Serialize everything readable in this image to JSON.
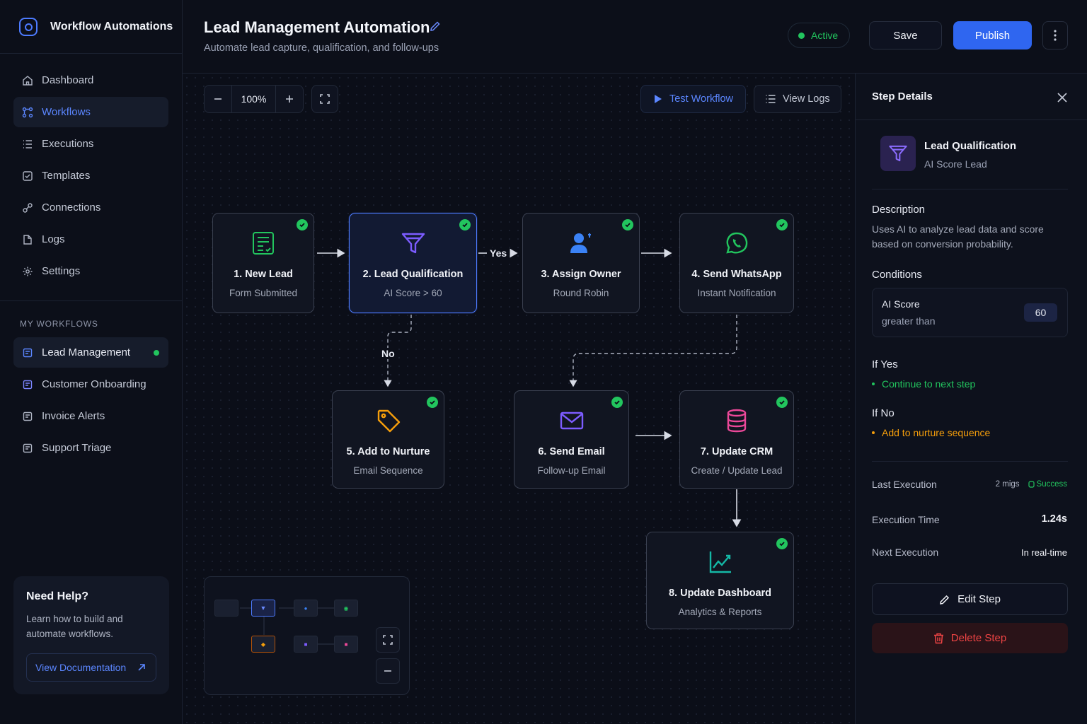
{
  "app": {
    "title": "Workflow Automations"
  },
  "nav": [
    {
      "label": "Dashboard",
      "icon": "home-icon",
      "active": false
    },
    {
      "label": "Workflows",
      "icon": "workflow-icon",
      "active": true
    },
    {
      "label": "Executions",
      "icon": "list-icon",
      "active": false
    },
    {
      "label": "Templates",
      "icon": "template-icon",
      "active": false
    },
    {
      "label": "Connections",
      "icon": "plug-icon",
      "active": false
    },
    {
      "label": "Logs",
      "icon": "file-icon",
      "active": false
    },
    {
      "label": "Settings",
      "icon": "gear-icon",
      "active": false
    }
  ],
  "my_workflows": {
    "heading": "MY WORKFLOWS",
    "items": [
      {
        "label": "Lead Management",
        "active": true
      },
      {
        "label": "Customer Onboarding",
        "active": false
      },
      {
        "label": "Invoice Alerts",
        "active": false
      },
      {
        "label": "Support Triage",
        "active": false
      }
    ]
  },
  "help": {
    "title": "Need Help?",
    "text": "Learn how to build and automate workflows.",
    "link": "View Documentation"
  },
  "header": {
    "title": "Lead Management Automation",
    "subtitle": "Automate lead capture, qualification, and follow-ups",
    "status": "Active",
    "save": "Save",
    "publish": "Publish"
  },
  "toolbar": {
    "zoom": "100%",
    "test": "Test Workflow",
    "logs": "View Logs"
  },
  "nodes": [
    {
      "title": "1. New Lead",
      "sub": "Form Submitted",
      "icon": "form-icon",
      "color": "#22c55e"
    },
    {
      "title": "2. Lead Qualification",
      "sub": "AI Score > 60",
      "icon": "filter-icon",
      "color": "#7c5cff"
    },
    {
      "title": "3. Assign Owner",
      "sub": "Round Robin",
      "icon": "user-icon",
      "color": "#3b82f6"
    },
    {
      "title": "4. Send WhatsApp",
      "sub": "Instant Notification",
      "icon": "whatsapp-icon",
      "color": "#22c55e"
    },
    {
      "title": "5. Add to Nurture",
      "sub": "Email Sequence",
      "icon": "tag-icon",
      "color": "#f59e0b"
    },
    {
      "title": "6. Send Email",
      "sub": "Follow-up Email",
      "icon": "mail-icon",
      "color": "#7c5cff"
    },
    {
      "title": "7. Update CRM",
      "sub": "Create / Update Lead",
      "icon": "database-icon",
      "color": "#ec4899"
    },
    {
      "title": "8. Update Dashboard",
      "sub": "Analytics & Reports",
      "icon": "chart-icon",
      "color": "#14b8a6"
    }
  ],
  "edges": {
    "yes": "Yes",
    "no": "No"
  },
  "panel": {
    "title": "Step Details",
    "step_title": "Lead Qualification",
    "step_sub": "AI Score Lead",
    "description_label": "Description",
    "description": "Uses AI to analyze lead data and score based on conversion probability.",
    "conditions_label": "Conditions",
    "condition": {
      "field": "AI Score",
      "operator": "greater than",
      "value": "60"
    },
    "if_yes_label": "If Yes",
    "if_yes": "Continue to next step",
    "if_no_label": "If No",
    "if_no": "Add to nurture sequence",
    "last_execution_label": "Last Execution",
    "last_execution_time": "2 migs",
    "last_execution_status": "Success",
    "execution_time_label": "Execution Time",
    "execution_time": "1.24s",
    "next_execution_label": "Next Execution",
    "next_execution": "In real-time",
    "edit": "Edit Step",
    "delete": "Delete Step"
  },
  "colors": {
    "accent": "#2f66f0",
    "success": "#22c55e",
    "danger": "#ef4444",
    "warning": "#f59e0b"
  }
}
